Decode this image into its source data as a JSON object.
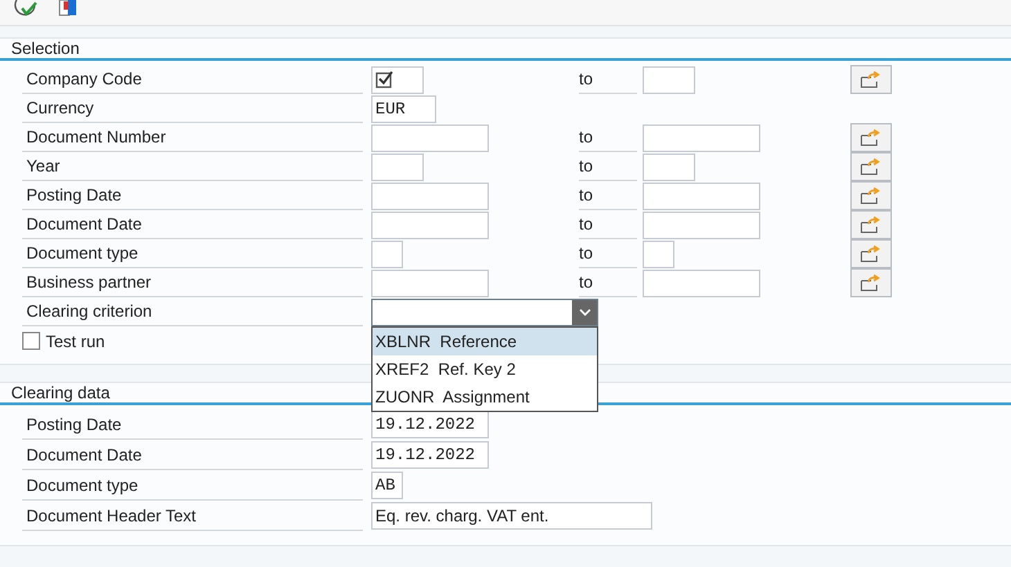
{
  "selection": {
    "title": "Selection",
    "rows": [
      {
        "label": "Company Code",
        "from": {
          "required": true
        },
        "to_label": "to",
        "to": {},
        "multiple": true
      },
      {
        "label": "Currency",
        "from": {
          "value": "EUR"
        }
      },
      {
        "label": "Document Number",
        "from": {},
        "to_label": "to",
        "to": {},
        "multiple": true
      },
      {
        "label": "Year",
        "from": {},
        "to_label": "to",
        "to": {},
        "multiple": true
      },
      {
        "label": "Posting Date",
        "from": {},
        "to_label": "to",
        "to": {},
        "multiple": true
      },
      {
        "label": "Document Date",
        "from": {},
        "to_label": "to",
        "to": {},
        "multiple": true
      },
      {
        "label": "Document type",
        "from": {},
        "to_label": "to",
        "to": {},
        "multiple": true
      },
      {
        "label": "Business partner",
        "from": {},
        "to_label": "to",
        "to": {},
        "multiple": true
      }
    ],
    "criterion": {
      "label": "Clearing criterion",
      "expanded": true,
      "options": [
        {
          "code": "XBLNR",
          "text": "Reference",
          "selected": true
        },
        {
          "code": "XREF2",
          "text": "Ref. Key 2",
          "selected": false
        },
        {
          "code": "ZUONR",
          "text": "Assignment",
          "selected": false
        }
      ]
    },
    "test_run": {
      "label": "Test run",
      "checked": false
    }
  },
  "clearing_data": {
    "title": "Clearing data",
    "rows": [
      {
        "label": "Posting Date",
        "value": "19.12.2022"
      },
      {
        "label": "Document Date",
        "value": "19.12.2022"
      },
      {
        "label": "Document type",
        "value": "AB"
      },
      {
        "label": "Document Header Text",
        "value": "Eq. rev. charg. VAT ent."
      }
    ]
  }
}
